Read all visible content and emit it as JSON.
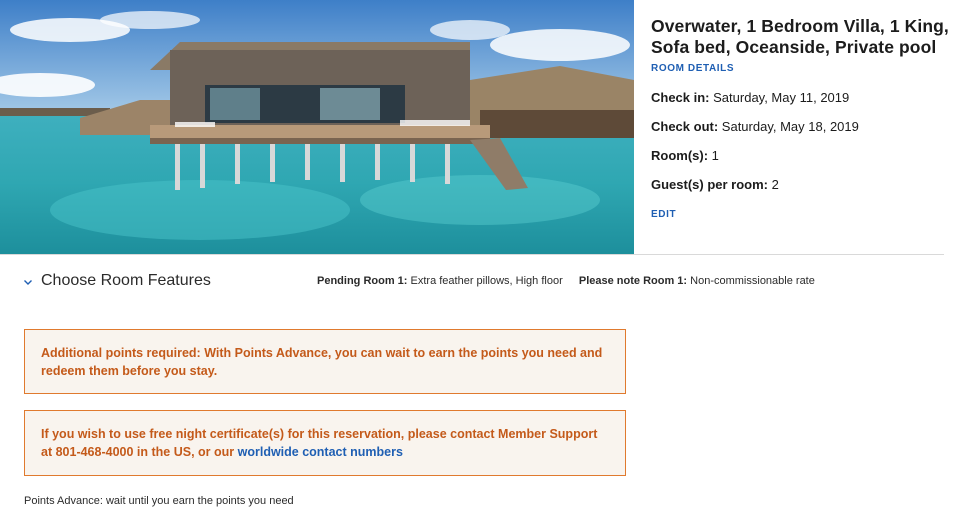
{
  "hero": {
    "image": "overwater-villa-photo"
  },
  "room": {
    "title": "Overwater, 1 Bedroom Villa, 1 King, Sofa bed, Oceanside, Private pool",
    "details_link": "ROOM DETAILS",
    "check_in_label": "Check in:",
    "check_in_value": "Saturday, May 11, 2019",
    "check_out_label": "Check out:",
    "check_out_value": "Saturday, May 18, 2019",
    "rooms_label": "Room(s):",
    "rooms_value": "1",
    "guests_label": "Guest(s) per room:",
    "guests_value": "2",
    "edit_link": "EDIT"
  },
  "features": {
    "label": "Choose Room Features",
    "icon": "chevron-down-icon",
    "pending_label": "Pending Room 1:",
    "pending_value": "Extra feather pillows, High floor",
    "note_label": "Please note Room 1:",
    "note_value": "Non-commissionable rate"
  },
  "notices": {
    "points_advance": "Additional points required: With Points Advance, you can wait to earn the points you need and redeem them before you stay.",
    "certificate_text": "If you wish to use free night certificate(s) for this reservation, please contact Member Support at 801-468-4000 in the US, or our",
    "certificate_link": "worldwide contact numbers"
  },
  "footer": {
    "note": "Points Advance: wait until you earn the points you need"
  },
  "colors": {
    "link_blue": "#1f5fb3",
    "notice_border": "#e07a2e",
    "notice_text": "#c45a1a",
    "notice_bg": "#f9f4ee"
  }
}
